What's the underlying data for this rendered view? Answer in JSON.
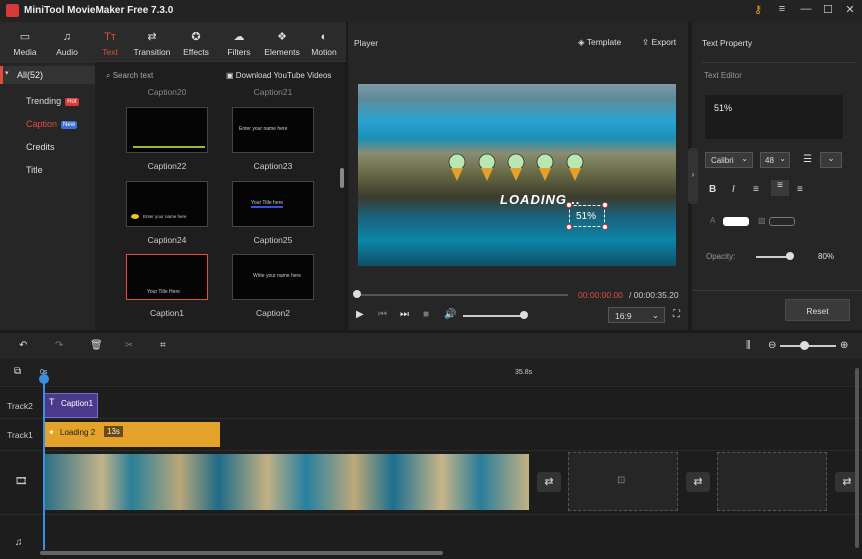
{
  "app": {
    "title": "MiniTool MovieMaker Free 7.3.0"
  },
  "window_controls": [
    "key-icon",
    "≡",
    "—",
    "☐",
    "✕"
  ],
  "tabs": [
    {
      "label": "Media",
      "icon": "▭"
    },
    {
      "label": "Audio",
      "icon": "♫"
    },
    {
      "label": "Text",
      "icon": "Tт"
    },
    {
      "label": "Transition",
      "icon": "⇄"
    },
    {
      "label": "Effects",
      "icon": "✪"
    },
    {
      "label": "Filters",
      "icon": "☁"
    },
    {
      "label": "Elements",
      "icon": "❖"
    },
    {
      "label": "Motion",
      "icon": "◐"
    }
  ],
  "nav": {
    "all": "All(52)",
    "items": [
      {
        "label": "Trending",
        "badge": "Hot"
      },
      {
        "label": "Caption",
        "badge": "New"
      },
      {
        "label": "Credits"
      },
      {
        "label": "Title"
      }
    ]
  },
  "search": {
    "placeholder": "Search text",
    "download": "Download YouTube Videos"
  },
  "captions": {
    "top_left": "Caption20",
    "top_right": "Caption21",
    "r1": [
      "Caption22",
      "Caption23"
    ],
    "r2": [
      "Caption24",
      "Caption25"
    ],
    "r3": [
      "Caption1",
      "Caption2"
    ],
    "thumb_texts": {
      "c23": "Enter your name here",
      "c24": "Enter your name here",
      "c25": "Your Title here",
      "c1": "Your Title Here",
      "c2": "Write your name here"
    }
  },
  "player": {
    "label": "Player",
    "template": "Template",
    "export": "Export",
    "time_current": "00:00:00.00",
    "time_total": "/ 00:00:35.20",
    "aspect": "16:9",
    "video_text": {
      "loading": "LOADING...",
      "percent": "51%"
    }
  },
  "text_property": {
    "title": "Text Property",
    "editor_label": "Text Editor",
    "text_value": "51%",
    "font": "Calibri",
    "size": "48",
    "opacity_label": "Opacity:",
    "opacity_value": "80%",
    "opacity": 0.8,
    "reset": "Reset"
  },
  "timeline": {
    "time_start": "0s",
    "time_mark": "35.8s",
    "tracks": [
      "Track2",
      "Track1"
    ],
    "caption_clip": "Caption1",
    "loading_clip": "Loading 2",
    "loading_duration": "13s",
    "zoom": 0.5
  },
  "colors": {
    "accent": "#e04d3f",
    "caption_clip": "#4a3a8c",
    "loading_clip": "#e3a32a"
  }
}
